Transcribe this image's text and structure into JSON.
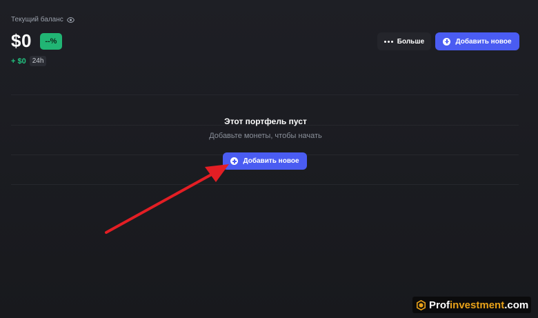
{
  "header": {
    "balance_label": "Текущий баланс",
    "balance_value": "$0",
    "percent_badge": "--%",
    "change_value": "+ $0",
    "change_period": "24h",
    "visibility_icon": "eye-icon"
  },
  "toolbar": {
    "more_label": "Больше",
    "more_icon": "more-dots-icon",
    "add_label": "Добавить новое",
    "add_icon": "plus-circle-icon"
  },
  "empty_state": {
    "title": "Этот портфель пуст",
    "subtitle": "Добавьте монеты, чтобы начать",
    "add_label": "Добавить новое"
  },
  "annotation": {
    "arrow_color": "#e31e24"
  },
  "watermark": {
    "prefix": "Prof",
    "accent": "investment",
    "suffix": ".com",
    "accent_color": "#e9a21a"
  },
  "colors": {
    "background": "#1b1c21",
    "primary": "#4a5cf2",
    "positive": "#21b574"
  }
}
